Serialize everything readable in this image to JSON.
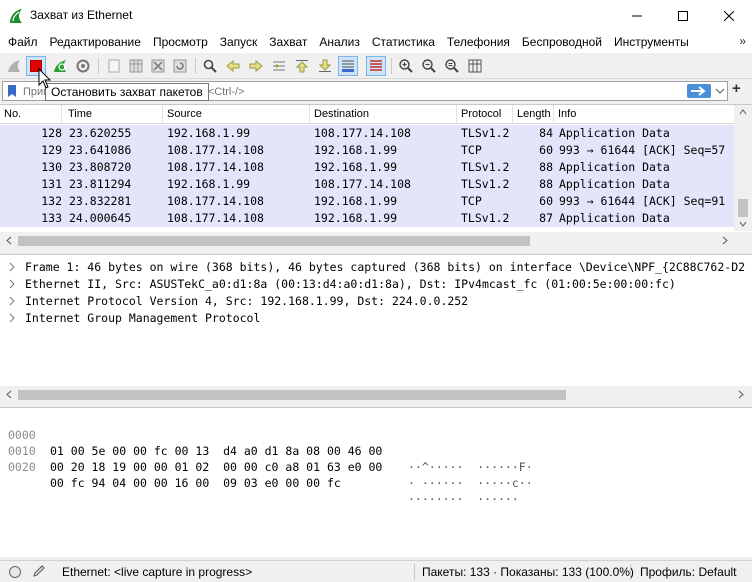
{
  "window": {
    "title": "Захват из Ethernet"
  },
  "menu": [
    "Файл",
    "Редактирование",
    "Просмотр",
    "Запуск",
    "Захват",
    "Анализ",
    "Статистика",
    "Телефония",
    "Беспроводной",
    "Инструменты"
  ],
  "menu_more": "»",
  "tooltip": "Остановить захват пакетов",
  "filter": {
    "placeholder": "Применить фильтр отображения … <Ctrl-/>",
    "visible_left": "При",
    "visible_right": "<Ctrl-/>"
  },
  "packet_list": {
    "columns": [
      "No.",
      "Time",
      "Source",
      "Destination",
      "Protocol",
      "Length",
      "Info"
    ],
    "rows": [
      [
        "128",
        "23.620255",
        "192.168.1.99",
        "108.177.14.108",
        "TLSv1.2",
        "84",
        "Application Data"
      ],
      [
        "129",
        "23.641086",
        "108.177.14.108",
        "192.168.1.99",
        "TCP",
        "60",
        "993 → 61644 [ACK] Seq=57"
      ],
      [
        "130",
        "23.808720",
        "108.177.14.108",
        "192.168.1.99",
        "TLSv1.2",
        "88",
        "Application Data"
      ],
      [
        "131",
        "23.811294",
        "192.168.1.99",
        "108.177.14.108",
        "TLSv1.2",
        "88",
        "Application Data"
      ],
      [
        "132",
        "23.832281",
        "108.177.14.108",
        "192.168.1.99",
        "TCP",
        "60",
        "993 → 61644 [ACK] Seq=91"
      ],
      [
        "133",
        "24.000645",
        "108.177.14.108",
        "192.168.1.99",
        "TLSv1.2",
        "87",
        "Application Data"
      ]
    ]
  },
  "details": [
    "Frame 1: 46 bytes on wire (368 bits), 46 bytes captured (368 bits) on interface \\Device\\NPF_{2C88C762-D2",
    "Ethernet II, Src: ASUSTekC_a0:d1:8a (00:13:d4:a0:d1:8a), Dst: IPv4mcast_fc (01:00:5e:00:00:fc)",
    "Internet Protocol Version 4, Src: 192.168.1.99, Dst: 224.0.0.252",
    "Internet Group Management Protocol"
  ],
  "bytes": [
    {
      "offset": "0000",
      "hex": "01 00 5e 00 00 fc 00 13  d4 a0 d1 8a 08 00 46 00",
      "ascii": "··^·····  ······F·"
    },
    {
      "offset": "0010",
      "hex": "00 20 18 19 00 00 01 02  00 00 c0 a8 01 63 e0 00",
      "ascii": "· ······  ·····c··"
    },
    {
      "offset": "0020",
      "hex": "00 fc 94 04 00 00 16 00  09 03 e0 00 00 fc",
      "ascii": "········  ······"
    }
  ],
  "status": {
    "interface": "Ethernet: <live capture in progress>",
    "packets": "Пакеты: 133 · Показаны: 133 (100.0%)",
    "profile": "Профиль: Default"
  },
  "colors": {
    "row_bg": "#e4e4fb",
    "stop_red": "#e00000",
    "filter_arrow": "#4a90d9"
  }
}
